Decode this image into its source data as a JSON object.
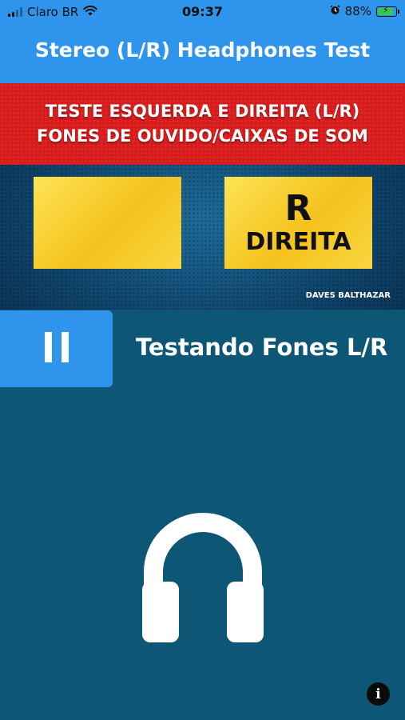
{
  "status_bar": {
    "carrier": "Claro BR",
    "time": "09:37",
    "battery_percent": "88%",
    "battery_level": 0.88,
    "icons": [
      "signal-icon",
      "wifi-icon",
      "alarm-icon",
      "battery-charging-icon"
    ]
  },
  "header": {
    "title": "Stereo (L/R) Headphones Test",
    "background_color": "#2f95ec"
  },
  "video": {
    "banner_line1": "TESTE ESQUERDA E DIREITA (L/R)",
    "banner_line2": "FONES DE OUVIDO/CAIXAS DE SOM",
    "left_panel": {
      "letter": "",
      "word": ""
    },
    "right_panel": {
      "letter": "R",
      "word": "DIREITA"
    },
    "credit": "DAVES BALTHAZAR",
    "banner_color": "#d81b1b",
    "panel_color": "#f7cf2f"
  },
  "player": {
    "control_icon": "pause-icon",
    "now_playing": "Testando Fones L/R"
  },
  "main": {
    "icon": "headphones-icon",
    "background_color": "#0e5675"
  },
  "footer": {
    "info_icon": "info-icon",
    "info_glyph": "i"
  }
}
